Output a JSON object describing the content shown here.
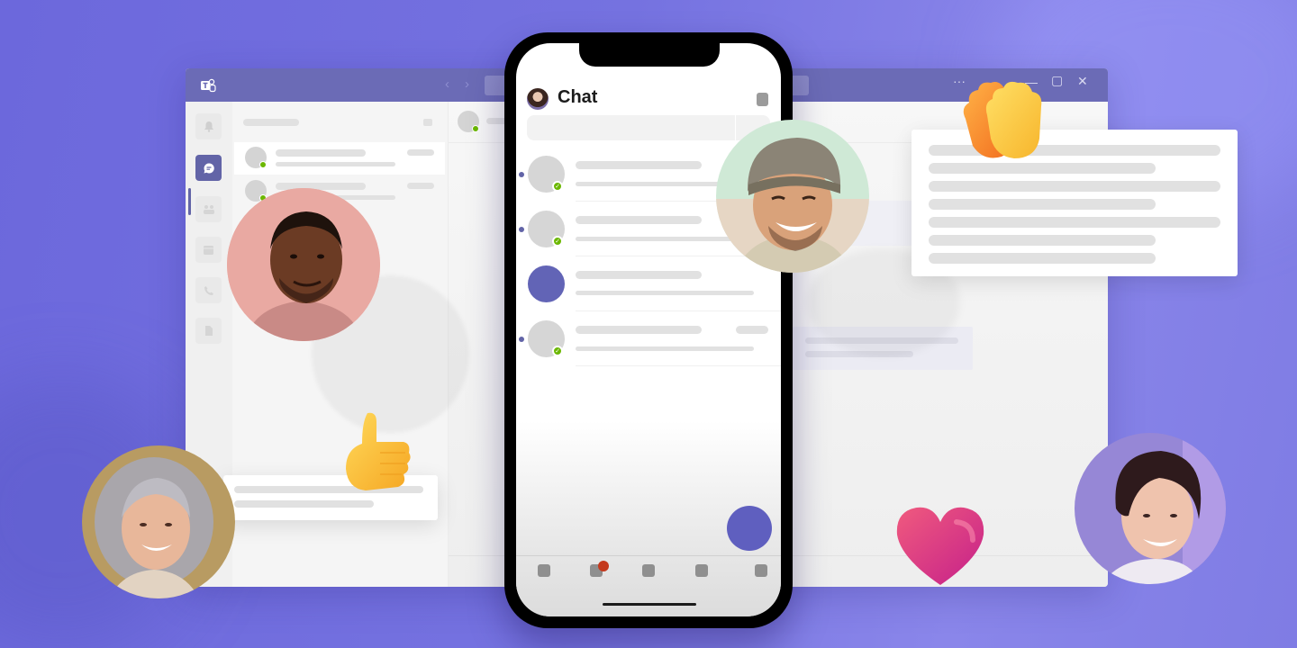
{
  "background": {
    "color": "#7370e0"
  },
  "desktop_window": {
    "app": "Microsoft Teams",
    "titlebar": {
      "logo_icon": "teams-logo-icon",
      "back_icon": "chevron-left-icon",
      "forward_icon": "chevron-right-icon",
      "more_label": "···",
      "minimize_label": "—",
      "maximize_label": "▢",
      "close_label": "✕",
      "color": "#6b6bb6"
    },
    "rail": {
      "items": [
        {
          "name": "activity",
          "icon": "bell-icon",
          "active": false
        },
        {
          "name": "chat",
          "icon": "chat-bubble-icon",
          "active": true
        },
        {
          "name": "teams",
          "icon": "people-icon",
          "active": false
        },
        {
          "name": "calendar",
          "icon": "calendar-icon",
          "active": false
        },
        {
          "name": "calls",
          "icon": "phone-icon",
          "active": false
        },
        {
          "name": "files",
          "icon": "file-icon",
          "active": false
        }
      ],
      "accent": "#6264a7"
    },
    "chat_list": {
      "items": [
        {
          "selected": true,
          "presence": "available"
        },
        {
          "selected": false,
          "presence": "available"
        }
      ]
    }
  },
  "phone": {
    "header": {
      "title": "Chat",
      "avatar": "user-avatar"
    },
    "chats": [
      {
        "unread": true,
        "presence": "available",
        "avatar": "placeholder"
      },
      {
        "unread": true,
        "presence": "available",
        "avatar": "placeholder"
      },
      {
        "unread": false,
        "presence": "none",
        "avatar": "group"
      },
      {
        "unread": true,
        "presence": "available",
        "avatar": "placeholder",
        "has_timestamp": true
      }
    ],
    "tabbar": [
      {
        "name": "activity",
        "badge": false
      },
      {
        "name": "chat",
        "badge": true
      },
      {
        "name": "teams",
        "badge": false
      },
      {
        "name": "calendar",
        "badge": false
      },
      {
        "name": "more",
        "badge": false
      }
    ],
    "fab": {
      "icon": "new-chat-icon",
      "color": "#5f5fbf"
    },
    "badge_color": "#c4391d",
    "presence_color": "#6bb700"
  },
  "participants": [
    {
      "name": "participant-man-pink-sweater",
      "bg": "#e8a7a0"
    },
    {
      "name": "participant-man-beanie",
      "bg": "#cde8d4"
    },
    {
      "name": "participant-woman-gray-hair",
      "bg": "#b89a5e"
    },
    {
      "name": "participant-woman-short-hair",
      "bg": "#9b8ad6"
    }
  ],
  "reactions": [
    {
      "name": "thumbs-up",
      "glyph": "👍"
    },
    {
      "name": "clapping-hands",
      "glyph": "👏"
    },
    {
      "name": "heart",
      "glyph": "❤"
    }
  ]
}
